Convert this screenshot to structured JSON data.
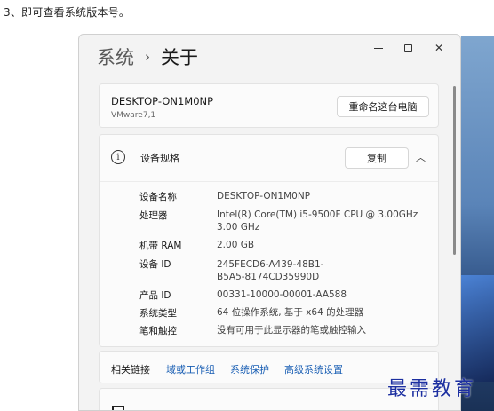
{
  "caption": "3、即可查看系统版本号。",
  "breadcrumb": {
    "parent": "系统",
    "separator": "›",
    "current": "关于"
  },
  "window_controls": {
    "minimize": "–",
    "maximize": "□",
    "close": "✕"
  },
  "device": {
    "name": "DESKTOP-ON1M0NP",
    "model": "VMware7,1",
    "rename_button": "重命名这台电脑"
  },
  "specs": {
    "title": "设备规格",
    "copy_button": "复制",
    "info_icon": "i",
    "chevron": "︿",
    "rows": [
      {
        "label": "设备名称",
        "value": "DESKTOP-ON1M0NP"
      },
      {
        "label": "处理器",
        "value": "Intel(R) Core(TM) i5-9500F CPU @ 3.00GHz",
        "value2": "3.00 GHz"
      },
      {
        "label": "机带 RAM",
        "value": "2.00 GB"
      },
      {
        "label": "设备 ID",
        "value": "245FECD6-A439-48B1-",
        "value2": "B5A5-8174CD35990D"
      },
      {
        "label": "产品 ID",
        "value": "00331-10000-00001-AA588"
      },
      {
        "label": "系统类型",
        "value": "64 位操作系统, 基于 x64 的处理器"
      },
      {
        "label": "笔和触控",
        "value": "没有可用于此显示器的笔或触控输入"
      }
    ]
  },
  "related": {
    "label": "相关链接",
    "links": [
      "域或工作组",
      "系统保护",
      "高级系统设置"
    ]
  },
  "watermark": "最需教育"
}
